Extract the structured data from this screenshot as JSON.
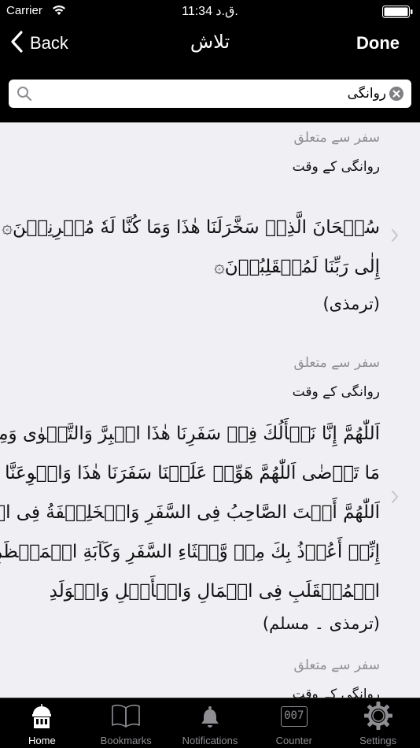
{
  "status": {
    "carrier": "Carrier",
    "time": "11:34 ق.د."
  },
  "nav": {
    "back_label": "Back",
    "title": "تلاش",
    "done_label": "Done"
  },
  "search": {
    "value": "روانگی",
    "placeholder": ""
  },
  "results": [
    {
      "category": "سفر سے متعلق",
      "subtitle": "روانگی کے وقت",
      "lines": [
        "سُبۡحَانَ الَّذِیۡ سَخَّرَلَنَا ھٰذَا وَمَا کُنَّا لَهٗ مُقۡرِنِیۡنَ۞ وَ إِنَّا",
        "إِلٰی رَبِّنَا لَمُنۡقَلِبُوۡنَ۞"
      ],
      "source": "(ترمذی)"
    },
    {
      "category": "سفر سے متعلق",
      "subtitle": "روانگی کے وقت",
      "lines": [
        "اَللّٰھُمَّ إِنَّا نَسۡأَلُكَ فِیۡ سَفَرِنَا ھٰذَا الۡبِرَّ وَالتَّقۡوٰی وَمِنَ الۡعَمَلِ",
        "مَا تَرۡضٰی اَللّٰھُمَّ ھَوِّنۡ عَلَیۡنَا سَفَرَنَا ھٰذَا وَاطۡوِعَنَّا بُعۡدَهٗ",
        "اَللّٰھُمَّ أَنۡتَ الصَّاحِبُ فِی السَّفَرِ وَالۡخَلِیۡفَةُ فِی الۡأَھۡلِ اَللّٰھُمَّ",
        "إِنِّیۡ أَعُوۡذُ بِكَ مِنۡ وَّعۡثَاءِ السَّفَرِ وَکَآبَةِ الۡمَنۡظَرِ وَسُوۡءِ",
        "الۡمُنۡقَلَبِ فِی الۡمَالِ وَالۡأَھۡلِ وَالۡوَلَدِ"
      ],
      "source": "(ترمذی ۔ مسلم)"
    },
    {
      "category": "سفر سے متعلق",
      "subtitle": "روانگی کے وقت"
    }
  ],
  "tabs": [
    {
      "label": "Home",
      "icon": "home-icon",
      "active": true
    },
    {
      "label": "Bookmarks",
      "icon": "book-icon",
      "active": false
    },
    {
      "label": "Notifications",
      "icon": "bell-icon",
      "active": false
    },
    {
      "label": "Counter",
      "icon": "counter-icon",
      "active": false
    },
    {
      "label": "Settings",
      "icon": "gear-icon",
      "active": false
    }
  ],
  "tab_counter_display": "007",
  "colors": {
    "background": "#000000",
    "results_bg": "#efeff4",
    "secondary_text": "#8e8e93",
    "tab_active": "#ffffff",
    "tab_inactive": "#8e8e93"
  }
}
